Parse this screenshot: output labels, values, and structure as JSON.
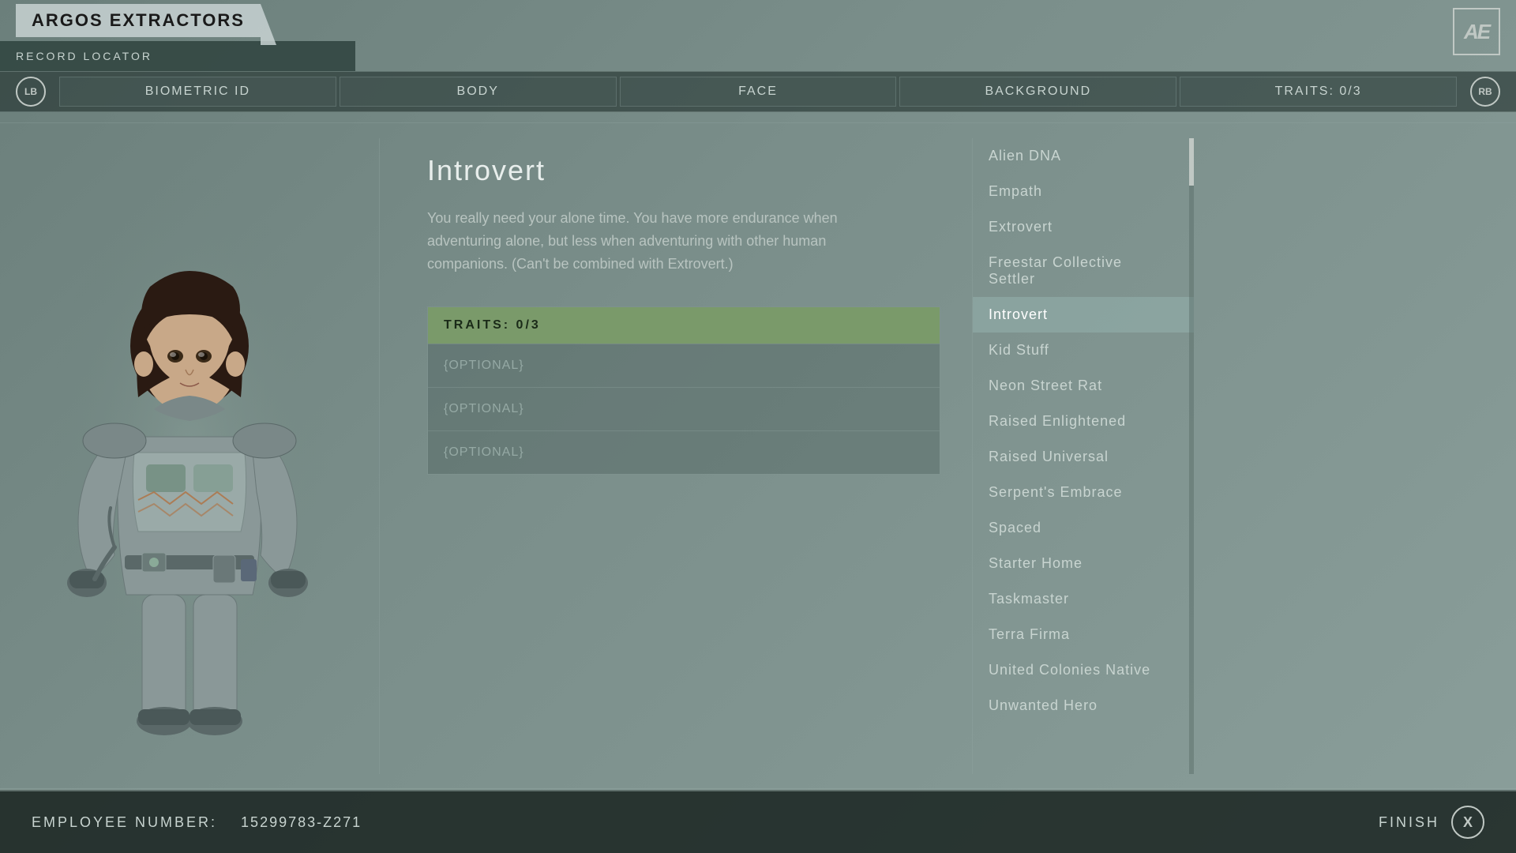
{
  "header": {
    "company_name": "ARGOS EXTRACTORS",
    "record_label": "RECORD LOCATOR",
    "logo": "AE"
  },
  "nav": {
    "lb_label": "LB",
    "rb_label": "RB",
    "tabs": [
      {
        "id": "biometric",
        "label": "BIOMETRIC ID"
      },
      {
        "id": "body",
        "label": "BODY"
      },
      {
        "id": "face",
        "label": "FACE"
      },
      {
        "id": "background",
        "label": "BACKGROUND"
      },
      {
        "id": "traits",
        "label": "TRAITS: 0/3"
      }
    ]
  },
  "selected_trait": {
    "name": "Introvert",
    "description": "You really need your alone time. You have more endurance when adventuring alone, but less when adventuring with other human companions. (Can't be combined with Extrovert.)"
  },
  "traits_box": {
    "header": "TRAITS: 0/3",
    "slots": [
      "{OPTIONAL}",
      "{OPTIONAL}",
      "{OPTIONAL}"
    ]
  },
  "traits_list": [
    {
      "id": "alien-dna",
      "label": "Alien DNA"
    },
    {
      "id": "empath",
      "label": "Empath"
    },
    {
      "id": "extrovert",
      "label": "Extrovert"
    },
    {
      "id": "freestar",
      "label": "Freestar Collective Settler"
    },
    {
      "id": "introvert",
      "label": "Introvert",
      "selected": true
    },
    {
      "id": "kid-stuff",
      "label": "Kid Stuff"
    },
    {
      "id": "neon-street-rat",
      "label": "Neon Street Rat"
    },
    {
      "id": "raised-enlightened",
      "label": "Raised Enlightened"
    },
    {
      "id": "raised-universal",
      "label": "Raised Universal"
    },
    {
      "id": "serpents-embrace",
      "label": "Serpent's Embrace"
    },
    {
      "id": "spaced",
      "label": "Spaced"
    },
    {
      "id": "starter-home",
      "label": "Starter Home"
    },
    {
      "id": "taskmaster",
      "label": "Taskmaster"
    },
    {
      "id": "terra-firma",
      "label": "Terra Firma"
    },
    {
      "id": "united-colonies",
      "label": "United Colonies Native"
    },
    {
      "id": "unwanted-hero",
      "label": "Unwanted Hero"
    }
  ],
  "bottom": {
    "employee_label": "EMPLOYEE NUMBER:",
    "employee_number": "15299783-Z271",
    "finish_label": "FINISH",
    "x_label": "X"
  }
}
